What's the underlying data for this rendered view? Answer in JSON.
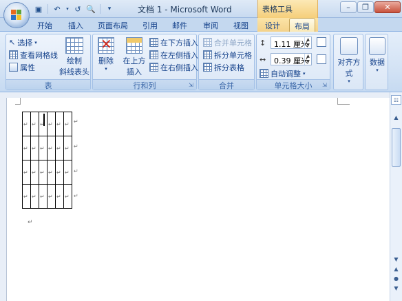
{
  "window": {
    "title": "文档 1 - Microsoft Word",
    "context_title": "表格工具"
  },
  "qat": {
    "save_icon": "save-icon",
    "undo_icon": "undo-icon",
    "redo_icon": "redo-icon",
    "preview_icon": "print-preview-icon",
    "customize_icon": "customize-icon"
  },
  "tabs": [
    "开始",
    "插入",
    "页面布局",
    "引用",
    "邮件",
    "审阅",
    "视图",
    "设计",
    "布局"
  ],
  "active_tab": "布局",
  "groups": {
    "table": {
      "label": "表",
      "select": "选择",
      "view_gridlines": "查看网格线",
      "properties": "属性",
      "draw_diagonal_line1": "绘制",
      "draw_diagonal_line2": "斜线表头"
    },
    "rows_cols": {
      "label": "行和列",
      "delete": "删除",
      "insert_above1": "在上方",
      "insert_above2": "插入",
      "insert_below": "在下方插入",
      "insert_left": "在左侧插入",
      "insert_right": "在右侧插入"
    },
    "merge": {
      "label": "合并",
      "merge_cells": "合并单元格",
      "split_cells": "拆分单元格",
      "split_table": "拆分表格"
    },
    "cell_size": {
      "label": "单元格大小",
      "height": "1.11 厘米",
      "width": "0.39 厘米",
      "autofit": "自动调整"
    },
    "alignment": {
      "label": "对齐方式"
    },
    "data": {
      "label": "数据"
    }
  },
  "document": {
    "cell_mark": "↵",
    "para_mark": "↵",
    "rows": 4,
    "cols": 6
  },
  "colors": {
    "ribbon_text": "#15428b",
    "context_tab": "#f5cf7b",
    "accent_blue": "#3e6aaa"
  }
}
